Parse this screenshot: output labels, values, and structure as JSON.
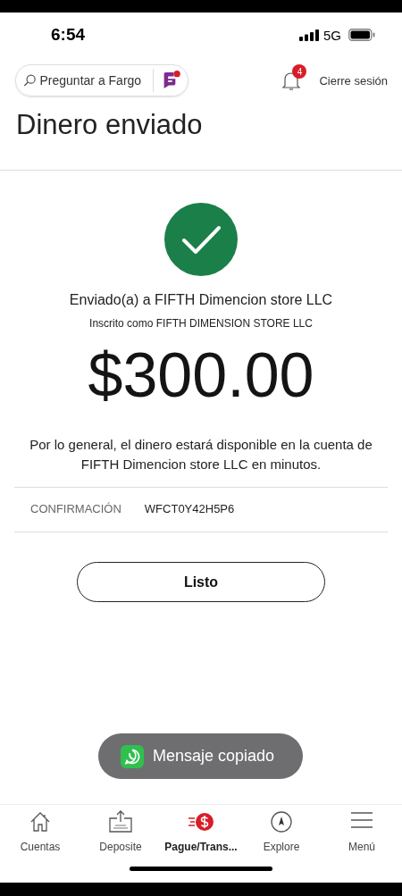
{
  "status_bar": {
    "time": "6:54",
    "network": "5G"
  },
  "header": {
    "search": {
      "placeholder": "Preguntar a Fargo"
    },
    "notifications": {
      "count": "4"
    },
    "logout": "Cierre sesión"
  },
  "title": "Dinero enviado",
  "confirmation": {
    "sent_to": "Enviado(a) a FIFTH Dimencion store LLC",
    "registered_as": "Inscrito como FIFTH DIMENSION STORE LLC",
    "amount": "$300.00",
    "note": "Por lo general, el dinero estará disponible en la cuenta de FIFTH Dimencion store LLC en minutos.",
    "label": "CONFIRMACIÓN",
    "code": "WFCT0Y42H5P6"
  },
  "done_button": "Listo",
  "toast": {
    "text": "Mensaje copiado"
  },
  "tab_bar": [
    {
      "label": "Cuentas",
      "kind": "home",
      "selected": false
    },
    {
      "label": "Deposite",
      "kind": "deposit",
      "selected": false
    },
    {
      "label": "Pague/Trans...",
      "kind": "pay",
      "selected": true
    },
    {
      "label": "Explore",
      "kind": "compass",
      "selected": false
    },
    {
      "label": "Menú",
      "kind": "menu",
      "selected": false
    }
  ]
}
